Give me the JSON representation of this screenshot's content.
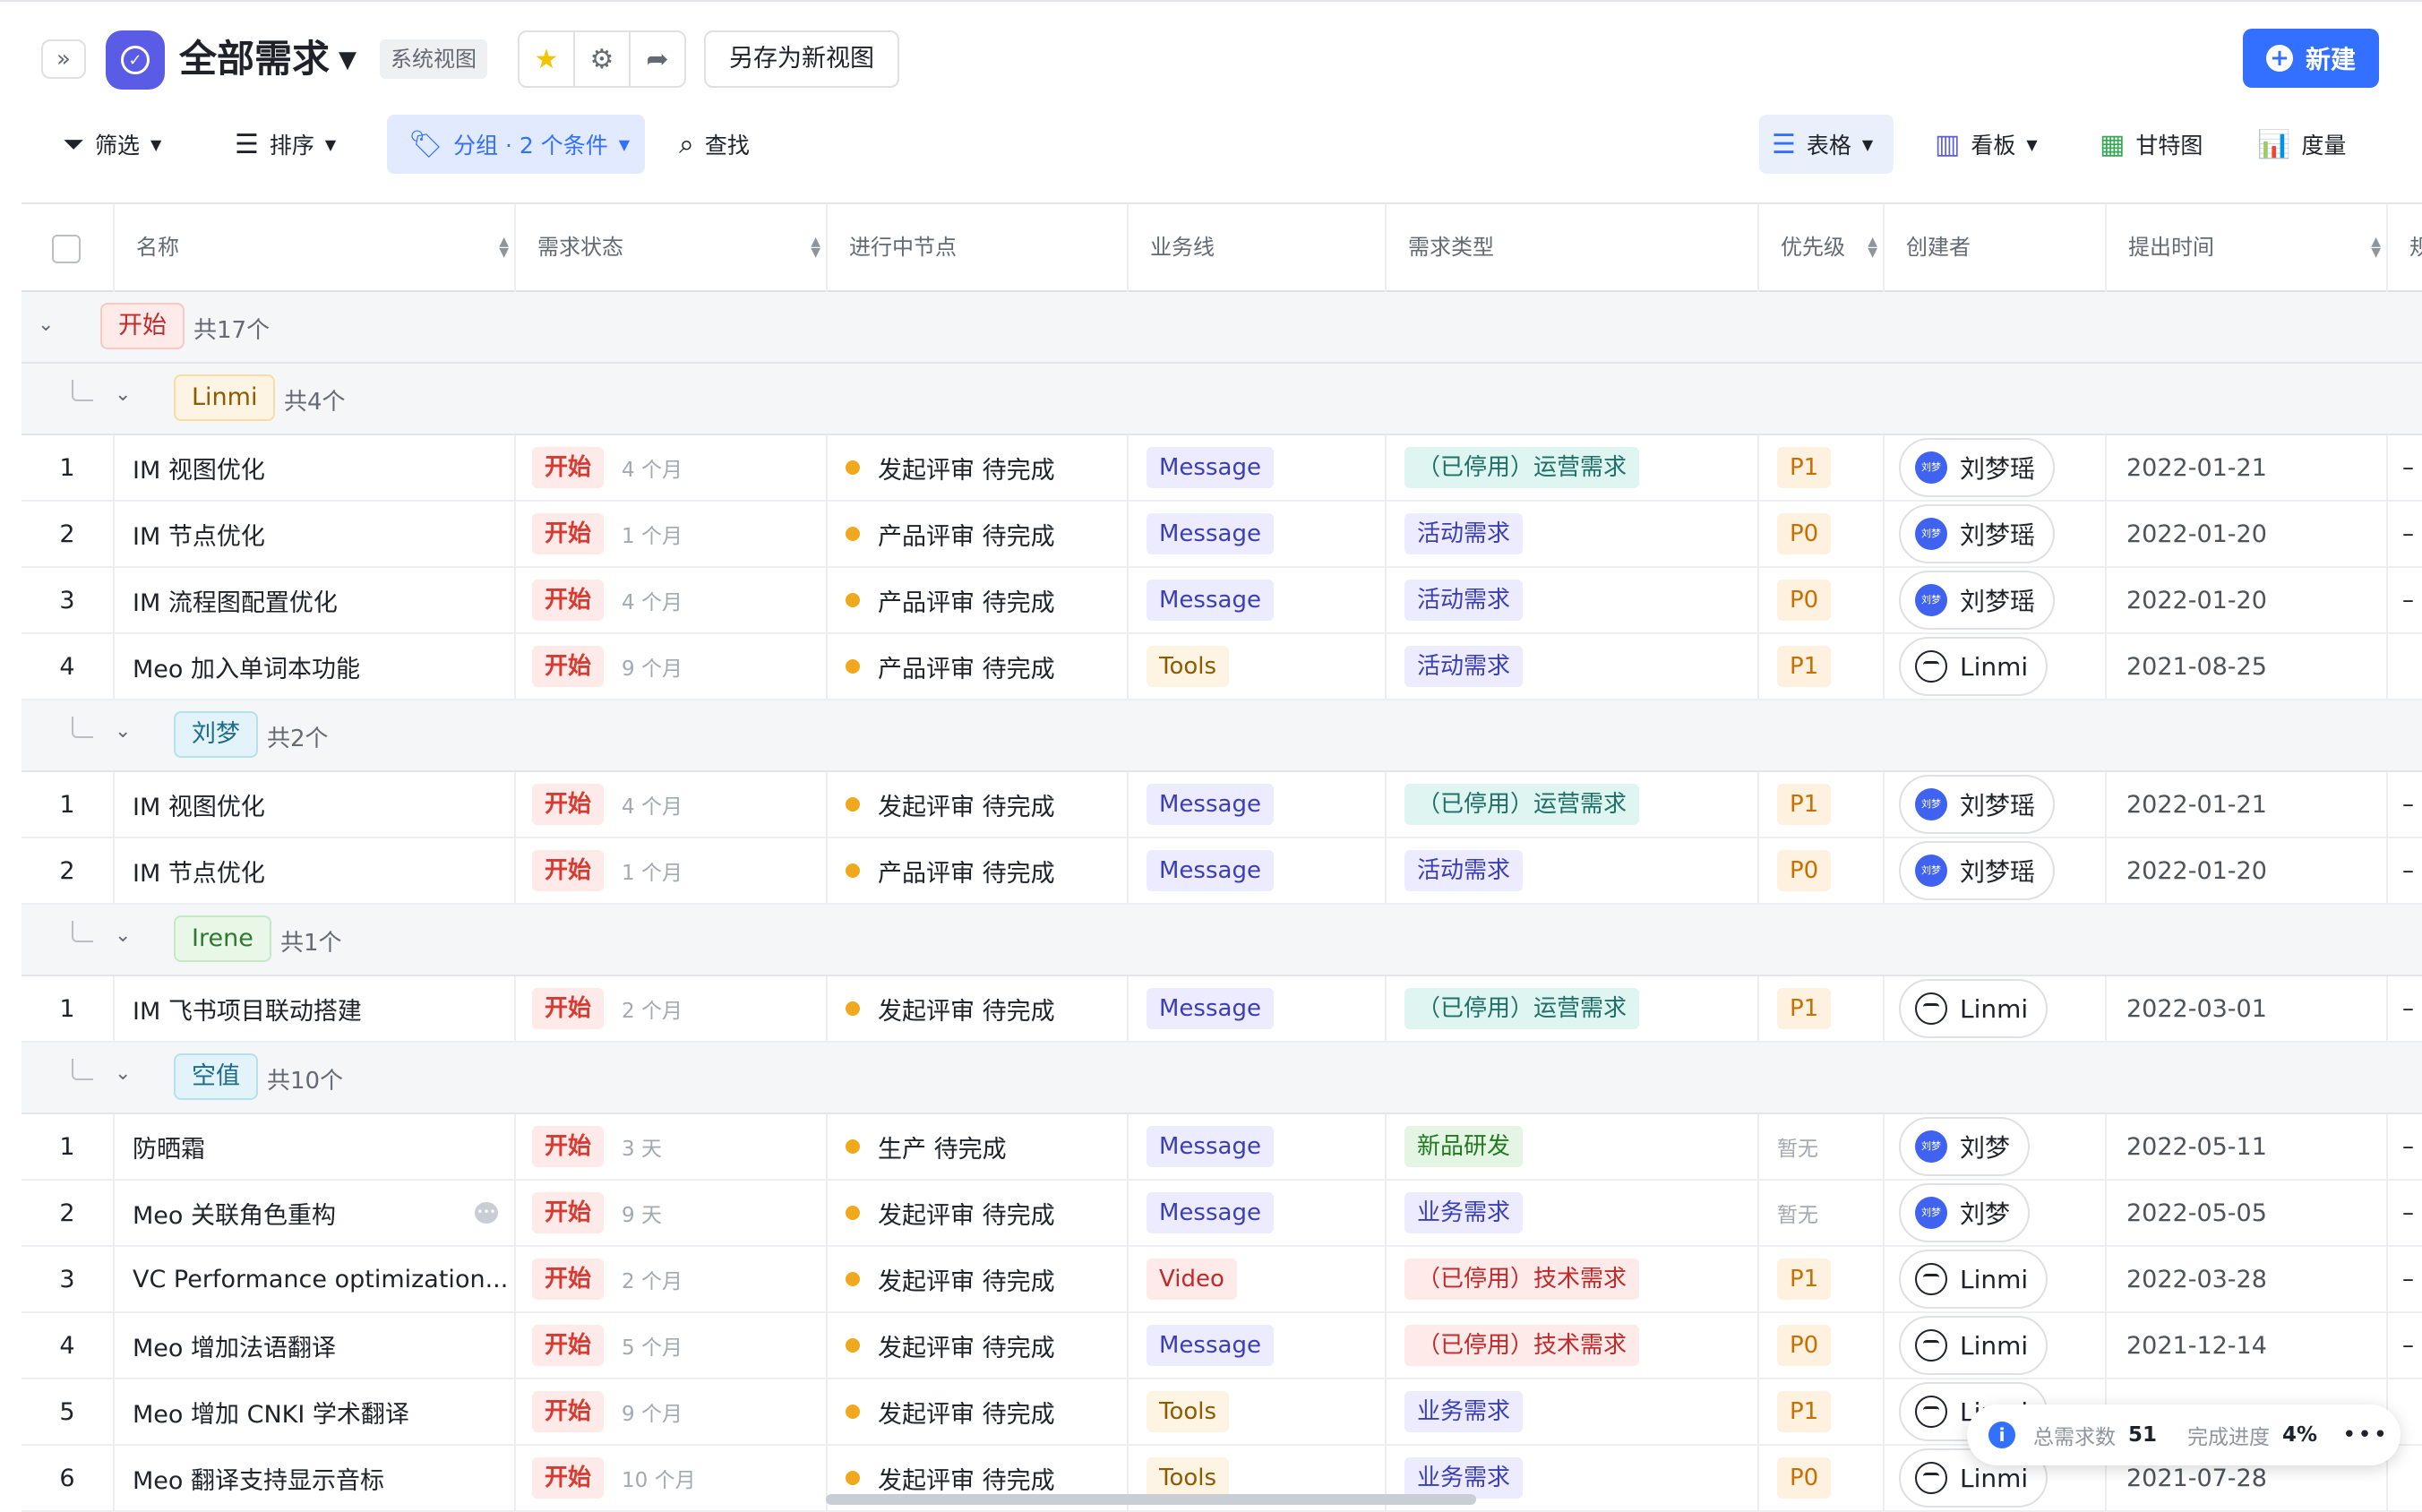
{
  "header": {
    "title": "全部需求",
    "system_view_badge": "系统视图",
    "save_as_label": "另存为新视图",
    "new_label": "新建"
  },
  "toolbar": {
    "filter_label": "筛选",
    "sort_label": "排序",
    "group_label": "分组 · 2 个条件",
    "find_label": "查找",
    "views": {
      "table": "表格",
      "board": "看板",
      "gantt": "甘特图",
      "measure": "度量"
    }
  },
  "columns": {
    "name": "名称",
    "status": "需求状态",
    "node": "进行中节点",
    "biz": "业务线",
    "type": "需求类型",
    "priority": "优先级",
    "creator": "创建者",
    "created": "提出时间",
    "next": "规"
  },
  "groups": {
    "top": {
      "label": "开始",
      "count": "共17个"
    },
    "sub": [
      {
        "label": "Linmi",
        "count": "共4个",
        "rows": [
          {
            "idx": "1",
            "name": "IM 视图优化",
            "status": "开始",
            "ago": "4 个月",
            "node": "发起评审 待完成",
            "biz": "Message",
            "type": "（已停用）运营需求",
            "priority": "P1",
            "creator": "刘梦瑶",
            "date": "2022-01-21",
            "next": "–"
          },
          {
            "idx": "2",
            "name": "IM 节点优化",
            "status": "开始",
            "ago": "1 个月",
            "node": "产品评审 待完成",
            "biz": "Message",
            "type": "活动需求",
            "priority": "P0",
            "creator": "刘梦瑶",
            "date": "2022-01-20",
            "next": "–"
          },
          {
            "idx": "3",
            "name": "IM 流程图配置优化",
            "status": "开始",
            "ago": "4 个月",
            "node": "产品评审 待完成",
            "biz": "Message",
            "type": "活动需求",
            "priority": "P0",
            "creator": "刘梦瑶",
            "date": "2022-01-20",
            "next": "–"
          },
          {
            "idx": "4",
            "name": "Meo 加入单词本功能",
            "status": "开始",
            "ago": "9 个月",
            "node": "产品评审 待完成",
            "biz": "Tools",
            "type": "活动需求",
            "priority": "P1",
            "creator": "Linmi",
            "date": "2021-08-25",
            "next": ""
          }
        ]
      },
      {
        "label": "刘梦",
        "count": "共2个",
        "rows": [
          {
            "idx": "1",
            "name": "IM 视图优化",
            "status": "开始",
            "ago": "4 个月",
            "node": "发起评审 待完成",
            "biz": "Message",
            "type": "（已停用）运营需求",
            "priority": "P1",
            "creator": "刘梦瑶",
            "date": "2022-01-21",
            "next": "–"
          },
          {
            "idx": "2",
            "name": "IM 节点优化",
            "status": "开始",
            "ago": "1 个月",
            "node": "产品评审 待完成",
            "biz": "Message",
            "type": "活动需求",
            "priority": "P0",
            "creator": "刘梦瑶",
            "date": "2022-01-20",
            "next": "–"
          }
        ]
      },
      {
        "label": "Irene",
        "count": "共1个",
        "rows": [
          {
            "idx": "1",
            "name": "IM 飞书项目联动搭建",
            "status": "开始",
            "ago": "2 个月",
            "node": "发起评审 待完成",
            "biz": "Message",
            "type": "（已停用）运营需求",
            "priority": "P1",
            "creator": "Linmi",
            "date": "2022-03-01",
            "next": "–"
          }
        ]
      },
      {
        "label": "空值",
        "count": "共10个",
        "rows": [
          {
            "idx": "1",
            "name": "防晒霜",
            "status": "开始",
            "ago": "3 天",
            "node": "生产 待完成",
            "biz": "Message",
            "type": "新品研发",
            "priority": "暂无",
            "creator": "刘梦",
            "date": "2022-05-11",
            "next": "–"
          },
          {
            "idx": "2",
            "name": "Meo 关联角色重构",
            "status": "开始",
            "ago": "9 天",
            "node": "发起评审 待完成",
            "biz": "Message",
            "type": "业务需求",
            "priority": "暂无",
            "creator": "刘梦",
            "date": "2022-05-05",
            "next": "–"
          },
          {
            "idx": "3",
            "name": "VC Performance optimization...",
            "status": "开始",
            "ago": "2 个月",
            "node": "发起评审 待完成",
            "biz": "Video",
            "type": "（已停用）技术需求",
            "priority": "P1",
            "creator": "Linmi",
            "date": "2022-03-28",
            "next": "–"
          },
          {
            "idx": "4",
            "name": "Meo 增加法语翻译",
            "status": "开始",
            "ago": "5 个月",
            "node": "发起评审 待完成",
            "biz": "Message",
            "type": "（已停用）技术需求",
            "priority": "P0",
            "creator": "Linmi",
            "date": "2021-12-14",
            "next": "–"
          },
          {
            "idx": "5",
            "name": "Meo 增加 CNKI 学术翻译",
            "status": "开始",
            "ago": "9 个月",
            "node": "发起评审 待完成",
            "biz": "Tools",
            "type": "业务需求",
            "priority": "P1",
            "creator": "Linmi",
            "date": "",
            "next": ""
          },
          {
            "idx": "6",
            "name": "Meo 翻译支持显示音标",
            "status": "开始",
            "ago": "10 个月",
            "node": "发起评审 待完成",
            "biz": "Tools",
            "type": "业务需求",
            "priority": "P0",
            "creator": "Linmi",
            "date": "2021-07-28",
            "next": ""
          }
        ]
      }
    ]
  },
  "avatar_text": "刘梦",
  "stats": {
    "total_label": "总需求数",
    "total_value": "51",
    "progress_label": "完成进度",
    "progress_value": "4%"
  },
  "colors": {
    "accent": "#3370ff",
    "app_icon": "#5b5ce6",
    "status_dot": "#f0a91d",
    "group_bg": "#f5f6f7"
  }
}
